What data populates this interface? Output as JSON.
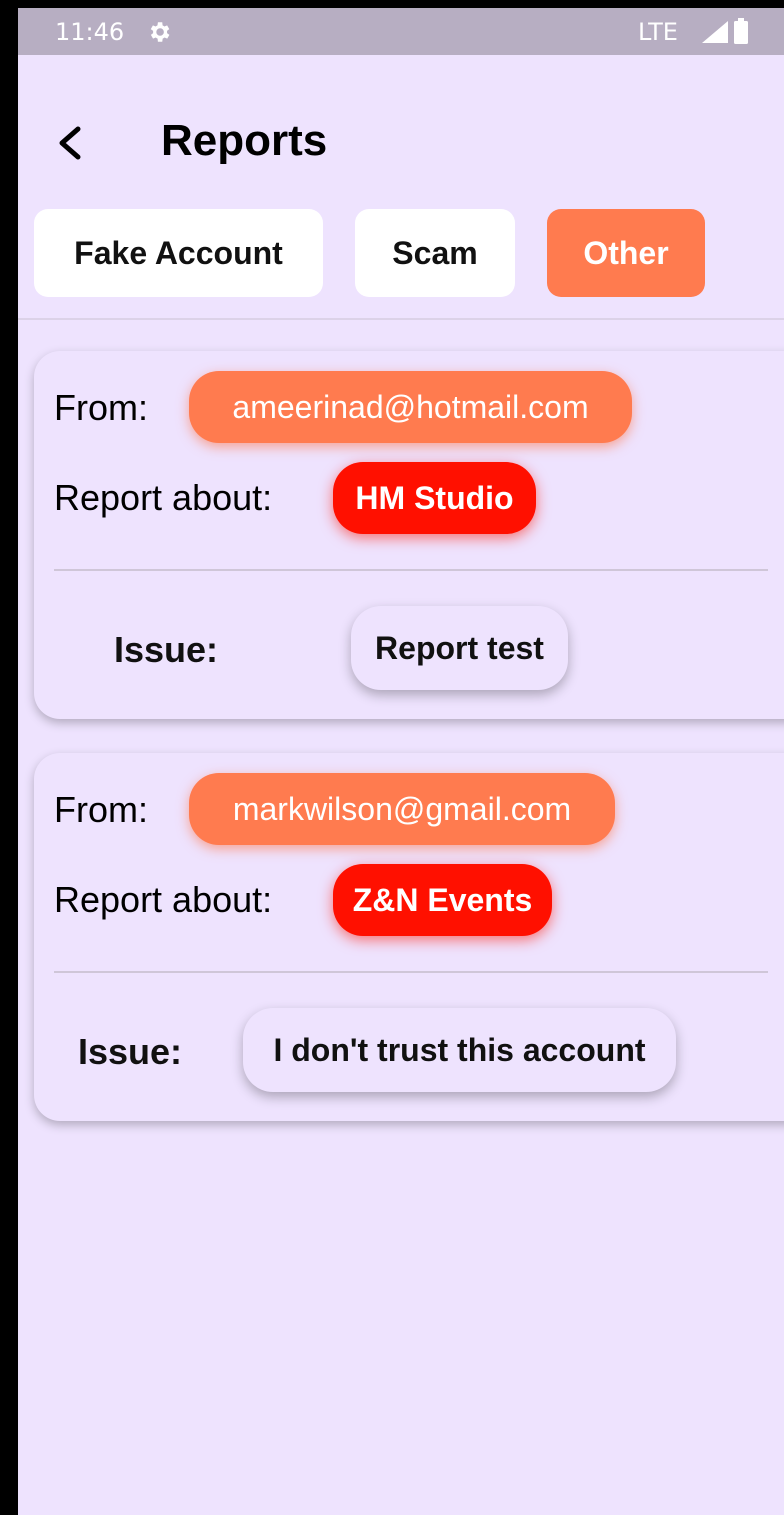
{
  "status_bar": {
    "time": "11:46",
    "network": "LTE",
    "settings_icon": "gear-icon",
    "signal_icon": "signal-icon",
    "battery_icon": "battery-icon"
  },
  "header": {
    "title": "Reports",
    "back_icon": "chevron-left-icon"
  },
  "tabs": [
    {
      "label": "Fake Account",
      "selected": false
    },
    {
      "label": "Scam",
      "selected": false
    },
    {
      "label": "Other",
      "selected": true
    }
  ],
  "reports": [
    {
      "from_label": "From:",
      "from": "ameerinad@hotmail.com",
      "about_label": "Report about:",
      "about": "HM Studio",
      "issue_label": "Issue:",
      "issue": "Report test"
    },
    {
      "from_label": "From:",
      "from": "markwilson@gmail.com",
      "about_label": "Report about:",
      "about": "Z&N Events",
      "issue_label": "Issue:",
      "issue": "I don't trust this account"
    }
  ],
  "colors": {
    "background": "#EEE3FE",
    "status_bar": "#B7AEC2",
    "accent": "#FF7B4F",
    "subject_badge": "#FF1000",
    "tab_background": "#FFFFFF"
  }
}
